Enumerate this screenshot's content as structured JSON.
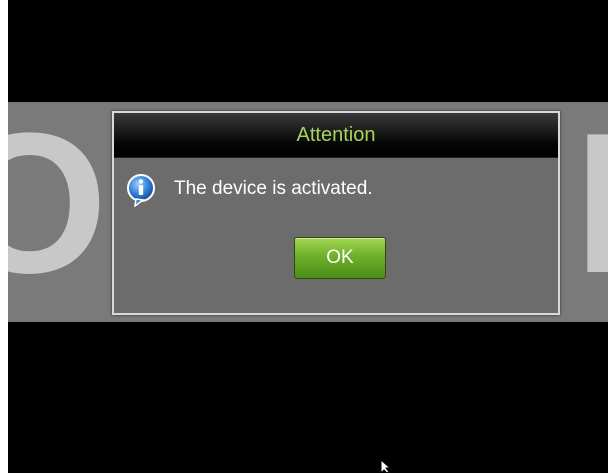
{
  "background": {
    "banner_left_letter": "O",
    "banner_right_letter": "N"
  },
  "dialog": {
    "title": "Attention",
    "message": "The device is activated.",
    "icon": "info-icon",
    "ok_label": "OK"
  },
  "colors": {
    "screen_background": "#000000",
    "dialog_background": "#6c6c6c",
    "title_text": "#a9d45a",
    "ok_button": "#6db12a",
    "info_icon_blue": "#2f7fd8"
  }
}
